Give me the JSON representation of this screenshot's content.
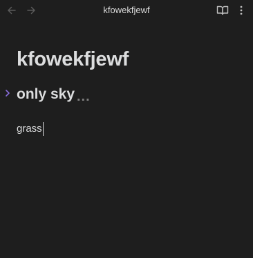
{
  "titlebar": {
    "title": "kfowekfjewf",
    "back_icon": "arrow-left-icon",
    "forward_icon": "arrow-right-icon",
    "reading_view_icon": "book-open-icon",
    "more_icon": "more-vertical-icon"
  },
  "note": {
    "inline_title": "kfowekfjewf",
    "heading": "only sky",
    "heading_collapsed_marker": "...",
    "body": "grass"
  },
  "colors": {
    "background": "#1e1e1e",
    "text": "#dcddde",
    "accent": "#8a6fe0",
    "muted": "#7e7e7e",
    "icon": "#bfbfbf",
    "icon_disabled": "#5a5a5a"
  }
}
